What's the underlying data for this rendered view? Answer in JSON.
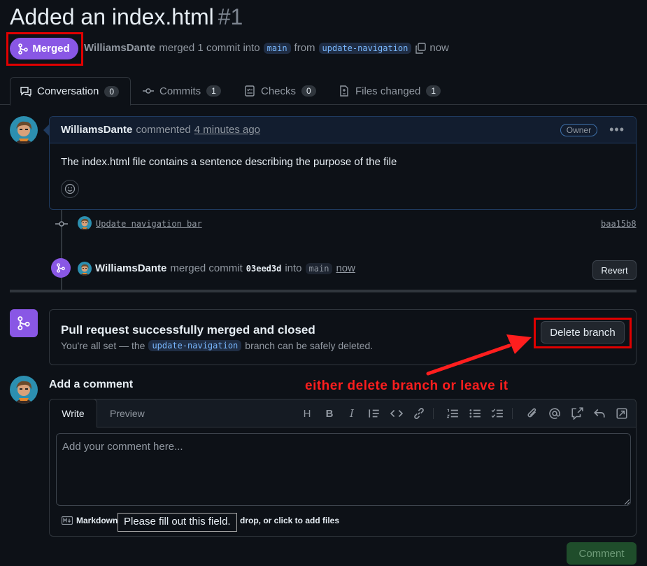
{
  "header": {
    "title": "Added an index.html",
    "number": "#1",
    "status": "Merged",
    "author": "WilliamsDante",
    "merged_text": "merged 1 commit into",
    "base_branch": "main",
    "from_text": "from",
    "head_branch": "update-navigation",
    "time": "now"
  },
  "tabs": [
    {
      "label": "Conversation",
      "count": "0",
      "icon": "comment-discussion-icon"
    },
    {
      "label": "Commits",
      "count": "1",
      "icon": "git-commit-icon"
    },
    {
      "label": "Checks",
      "count": "0",
      "icon": "checklist-icon"
    },
    {
      "label": "Files changed",
      "count": "1",
      "icon": "file-diff-icon"
    }
  ],
  "comment": {
    "author": "WilliamsDante",
    "action": "commented",
    "time": "4 minutes ago",
    "badge": "Owner",
    "body": "The index.html file contains a sentence describing the purpose of the file"
  },
  "commit_event": {
    "message": "Update navigation bar",
    "sha": "baa15b8"
  },
  "merge_event": {
    "author": "WilliamsDante",
    "text1": "merged commit",
    "sha": "03eed3d",
    "text2": "into",
    "branch": "main",
    "time": "now",
    "revert_label": "Revert"
  },
  "merge_panel": {
    "title": "Pull request successfully merged and closed",
    "desc_prefix": "You're all set — the",
    "branch": "update-navigation",
    "desc_suffix": "branch can be safely deleted.",
    "delete_label": "Delete branch"
  },
  "annotation": "either delete branch or leave it",
  "editor": {
    "heading": "Add a comment",
    "tab_write": "Write",
    "tab_preview": "Preview",
    "placeholder": "Add your comment here...",
    "markdown_label": "Markdown",
    "attach_text": "drop, or click to add files",
    "tooltip": "Please fill out this field.",
    "submit_label": "Comment"
  },
  "colors": {
    "merged": "#8957e5",
    "annotation": "#ff1e1e"
  }
}
